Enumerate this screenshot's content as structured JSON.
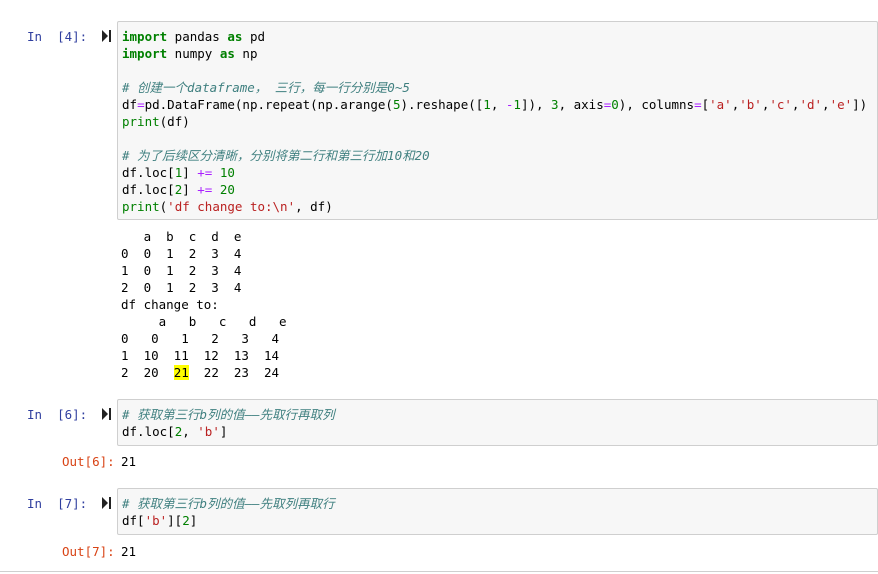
{
  "cells": [
    {
      "in_prompt": "In  [4]:",
      "code": [
        "import pandas as pd",
        "import numpy as np",
        "",
        "# 创建一个dataframe， 三行，每一行分别是0~5",
        "df=pd.DataFrame(np.repeat(np.arange(5).reshape([1, -1]), 3, axis=0), columns=['a','b','c','d','e'])",
        "print(df)",
        "",
        "# 为了后续区分清晰，分别将第二行和第三行加10和20",
        "df.loc[1] += 10",
        "df.loc[2] += 20",
        "print('df change to:\\n', df)"
      ],
      "output_lines": [
        "   a  b  c  d  e",
        "0  0  1  2  3  4",
        "1  0  1  2  3  4",
        "2  0  1  2  3  4",
        "df change to:",
        "     a   b   c   d   e",
        "0   0   1   2   3   4",
        "1  10  11  12  13  14",
        "2  20  21  22  23  24"
      ],
      "highlight": {
        "prefix": "2  20  ",
        "value": "21",
        "suffix": "  22  23  24"
      }
    },
    {
      "in_prompt": "In  [6]:",
      "code": [
        "# 获取第三行b列的值——先取行再取列",
        "df.loc[2, 'b']"
      ],
      "out_prompt": "Out[6]:",
      "result": "21"
    },
    {
      "in_prompt": "In  [7]:",
      "code": [
        "# 获取第三行b列的值——先取列再取行",
        "df['b'][2]"
      ],
      "out_prompt": "Out[7]:",
      "result": "21"
    }
  ],
  "colors": {
    "in_prompt": "#303f9f",
    "out_prompt": "#d84315",
    "keyword": "#008000",
    "comment": "#408080",
    "operator": "#aa22ff",
    "string": "#ba2121",
    "highlight": "#ffff00"
  },
  "icons": {
    "run": "run-cell-icon"
  }
}
